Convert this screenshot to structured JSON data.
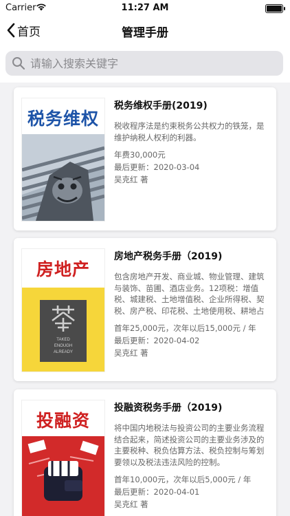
{
  "status_bar": {
    "carrier": "Carrier",
    "time": "11:27 AM"
  },
  "nav": {
    "back_label": "首页",
    "title": "管理手册"
  },
  "search": {
    "placeholder": "请输入搜索关键字"
  },
  "books": [
    {
      "title": "税务维权手册(2019)",
      "cover_text": "税务维权",
      "cover_color": "#1e54a8",
      "description": "税收程序法是约束税务公共权力的铁笼，是维护纳税人权利的利器。",
      "price": "年费30,000元",
      "updated": "最后更新：2020-03-04",
      "author": "吴克红 著"
    },
    {
      "title": "房地产税务手册（2019)",
      "cover_text": "房地产",
      "cover_color": "#cf2020",
      "cover_art_text": [
        "TAKED",
        "ENOUGH",
        "ALREADY"
      ],
      "description": "包含房地产开发、商业城、物业管理、建筑与装饰、苗圃、酒店业务。12项税：增值税、城建税、土地增值税、企业所得税、契税、房产税、印花税、土地使用税、耕地占用税、个人所得税、环境保...",
      "price": "首年25,000元，次年以后15,000元 / 年",
      "updated": "最后更新：2020-04-02",
      "author": "吴克红 著"
    },
    {
      "title": "投融资税务手册（2019)",
      "cover_text": "投融资",
      "cover_color": "#cf2020",
      "description": "将中国内地税法与投资公司的主要业务流程结合起来，简述投资公司的主要业务涉及的主要税种、税负估算方法、税负控制与筹划要领以及税法违法风险的控制。",
      "price": "首年10,000元，次年以后5,000元 / 年",
      "updated": "最后更新：2020-04-01",
      "author": "吴克红 著"
    }
  ]
}
